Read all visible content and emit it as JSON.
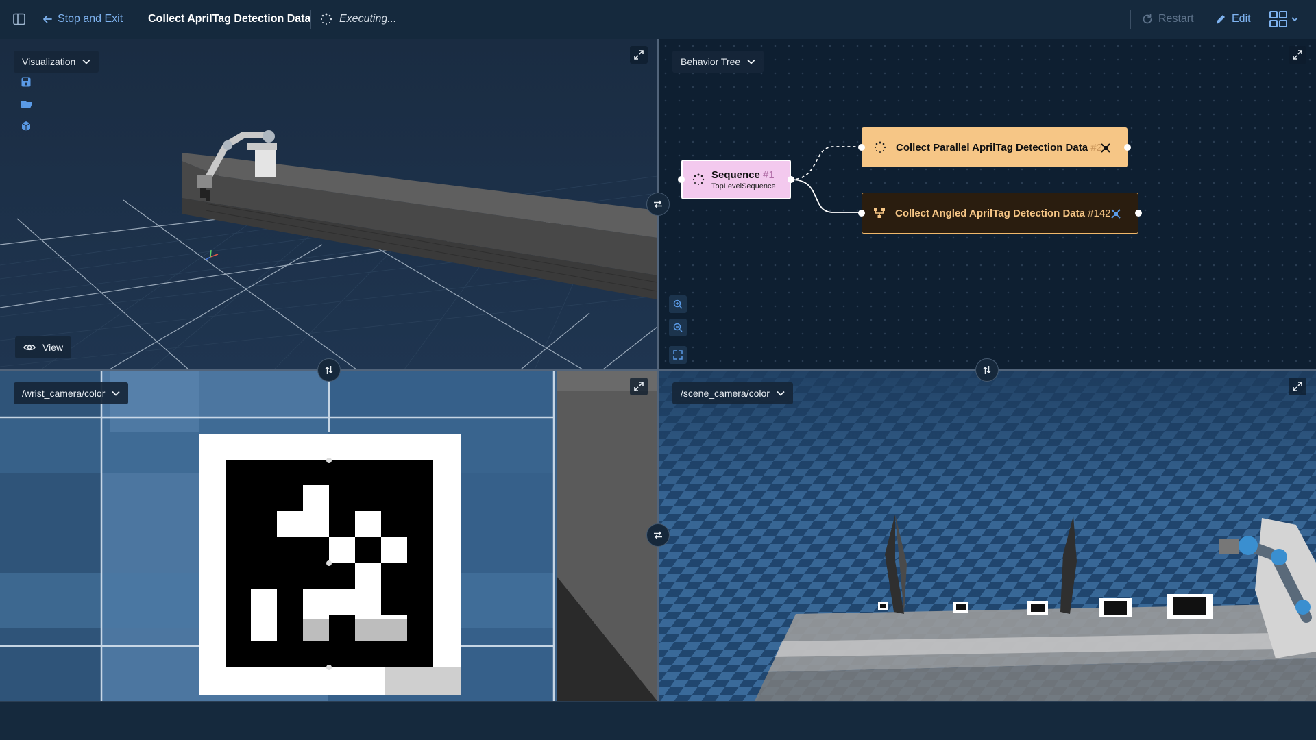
{
  "topbar": {
    "stop_label": "Stop and Exit",
    "run_title": "Collect AprilTag Detection Data",
    "status": "Executing...",
    "restart_label": "Restart",
    "edit_label": "Edit"
  },
  "panes": {
    "visualization": {
      "select_label": "Visualization",
      "view_label": "View"
    },
    "behavior_tree": {
      "select_label": "Behavior Tree",
      "nodes": [
        {
          "title": "Sequence",
          "number": "#1",
          "subtitle": "TopLevelSequence",
          "color": "#f3c9ee"
        },
        {
          "title": "Collect Parallel AprilTag Detection Data",
          "number": "#2",
          "color": "#f6c686"
        },
        {
          "title": "Collect Angled AprilTag Detection Data",
          "number": "#142",
          "color": "#f0b86b"
        }
      ]
    },
    "wrist_camera": {
      "select_label": "/wrist_camera/color"
    },
    "scene_camera": {
      "select_label": "/scene_camera/color"
    }
  },
  "colors": {
    "accent": "#7fb3f0",
    "background": "#15293d",
    "disabled": "#5e738b"
  },
  "icons": {
    "sidebar_toggle": "sidebar-toggle-icon",
    "back": "arrow-left-icon",
    "spinner": "spinner-icon",
    "restart": "refresh-icon",
    "edit": "pencil-icon",
    "layout": "layout-grid-icon",
    "save": "save-icon",
    "open": "folder-open-icon",
    "model": "cube-icon",
    "view": "eye-icon"
  }
}
